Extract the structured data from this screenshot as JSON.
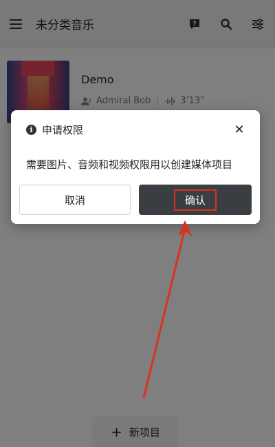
{
  "header": {
    "title": "未分类音乐",
    "icons": [
      "menu-icon",
      "help-icon",
      "search-icon",
      "filter-icon"
    ]
  },
  "track": {
    "title": "Demo",
    "artist": "Admiral Bob",
    "duration": "3’13”"
  },
  "dialog": {
    "title": "申请权限",
    "message": "需要图片、音频和视频权限用以创建媒体项目",
    "cancel_label": "取消",
    "confirm_label": "确认"
  },
  "fab": {
    "label": "新项目"
  },
  "colors": {
    "confirm_bg": "#3a3d42",
    "highlight": "#d8331f"
  }
}
